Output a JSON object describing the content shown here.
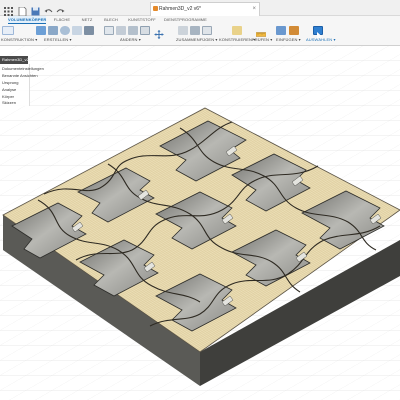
{
  "window": {
    "document_title": "Rahmen3D_v2 v6*",
    "icons": [
      "grid-icon",
      "file-icon",
      "save-icon",
      "undo-icon",
      "redo-icon"
    ]
  },
  "ribbon": {
    "tabs": [
      "VOLUMENKÖRPER",
      "FLÄCHE",
      "NETZ",
      "BLECH",
      "KUNSTSTOFF",
      "DIENSTPROGRAMME"
    ],
    "active_tab": "VOLUMENKÖRPER"
  },
  "toolbar": {
    "workspace": "KONSTRUKTION ▾",
    "groups": {
      "erstellen": "ERSTELLEN ▾",
      "aendern": "ÄNDERN ▾",
      "zusammenfuegen": "ZUSAMMENFÜGEN ▾",
      "konstruieren": "KONSTRUIEREN ▾",
      "pruefen": "PRÜFEN ▾",
      "einfuegen": "EINFÜGEN ▾",
      "auswaehlen": "AUSWÄHLEN ▾"
    }
  },
  "browser": {
    "header": "Rahmen3D_v2 v6",
    "items": [
      "Dokumenteinstellungen",
      "Benannte Ansichten",
      "Ursprung",
      "Analyse",
      "Körper",
      "Skizzen"
    ]
  },
  "viewport": {
    "background": "#ffffff",
    "grid_color": "#d6d6d6",
    "wood_color": "#e9dcb4",
    "base_color": "#5b5b57",
    "pocket_color": "#9a9a96"
  }
}
